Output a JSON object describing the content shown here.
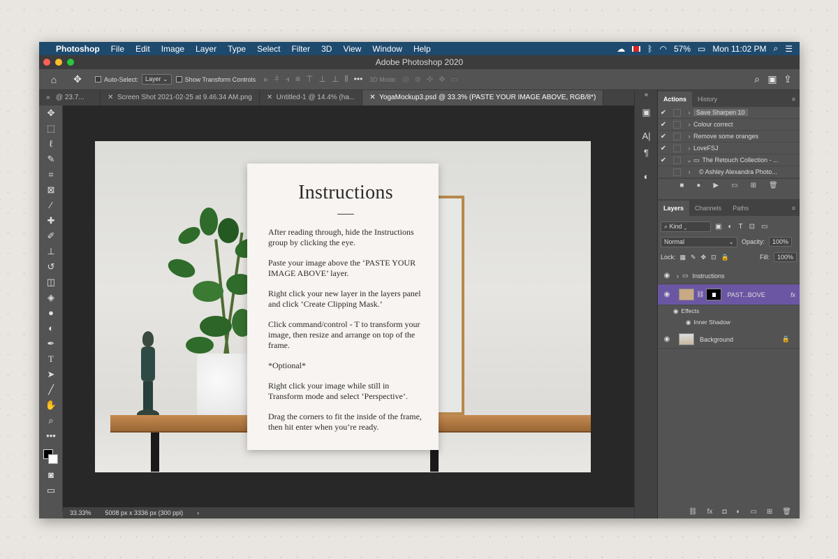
{
  "menubar": {
    "apple": "",
    "app": "Photoshop",
    "items": [
      "File",
      "Edit",
      "Image",
      "Layer",
      "Type",
      "Select",
      "Filter",
      "3D",
      "View",
      "Window",
      "Help"
    ],
    "battery": "57%",
    "clock": "Mon 11:02 PM"
  },
  "title": "Adobe Photoshop 2020",
  "options": {
    "auto_select_label": "Auto-Select:",
    "auto_select_value": "Layer",
    "show_transform": "Show Transform Controls",
    "mode_3d": "3D Mode:"
  },
  "tabs": [
    "\u0018 @ 23.7...",
    "Screen Shot 2021-02-25 at 9.46.34 AM.png",
    "Untitled-1 @ 14.4% (ha...",
    "YogaMockup3.psd @ 33.3% (PASTE YOUR IMAGE ABOVE, RGB/8*)"
  ],
  "card": {
    "title": "Instructions",
    "paragraphs": [
      "After reading through, hide the Instructions group by clicking the eye.",
      "Paste your image above the ‘PASTE YOUR IMAGE ABOVE’ layer.",
      "Right click your new layer in the layers panel and click ‘Create Clipping Mask.’",
      "Click command/control - T to transform your image, then resize and arrange on top of the frame.",
      "*Optional*",
      "Right click your image while still in Transform mode and select ‘Perspective’.",
      "Drag the corners to fit the inside of the frame, then hit enter when you’re ready."
    ]
  },
  "status": {
    "zoom": "33.33%",
    "doc": "5008 px x 3336 px (300 ppi)"
  },
  "actions": {
    "tabs": [
      "Actions",
      "History"
    ],
    "rows": [
      "Save Sharpen 10",
      "Colour correct",
      "Remove some oranges",
      "LoveFSJ",
      "The Retouch Collection - ...",
      "© Ashley Alexandra Photo..."
    ]
  },
  "layers": {
    "tabs": [
      "Layers",
      "Channels",
      "Paths"
    ],
    "kind": "Kind",
    "blend": "Normal",
    "opacity_label": "Opacity:",
    "opacity": "100%",
    "lock_label": "Lock:",
    "fill_label": "Fill:",
    "fill": "100%",
    "items": {
      "group": "Instructions",
      "paste": "PAST...BOVE",
      "effects": "Effects",
      "inner": "Inner Shadow",
      "bg": "Background"
    }
  }
}
